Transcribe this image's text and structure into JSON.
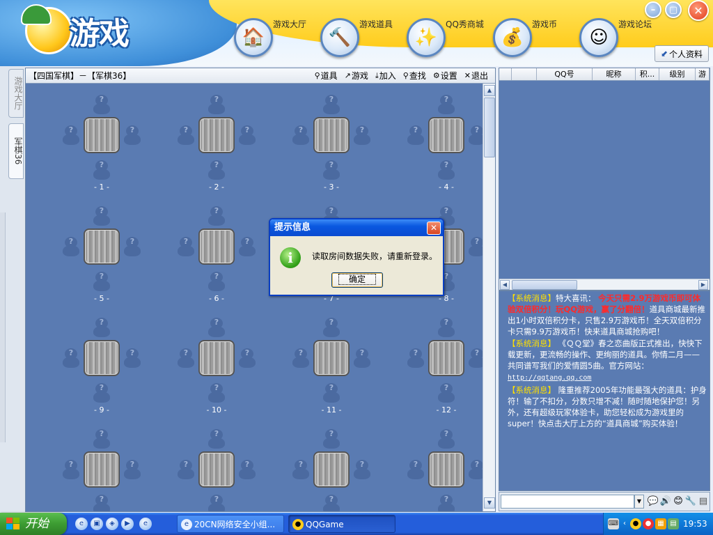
{
  "header": {
    "logo_text": "游戏",
    "nav": [
      {
        "label": "游戏大厅",
        "icon": "house-icon"
      },
      {
        "label": "游戏道具",
        "icon": "hammer-icon"
      },
      {
        "label": "QQ秀商城",
        "icon": "magic-wand-icon"
      },
      {
        "label": "游戏币",
        "icon": "coins-icon"
      },
      {
        "label": "游戏论坛",
        "icon": "avatar-icon"
      }
    ],
    "profile_label": "个人资料"
  },
  "left_tabs": {
    "lobby": "游戏大厅",
    "room": "军棋36"
  },
  "room": {
    "title": "【四国军棋】－【军棋36】",
    "tools": [
      {
        "label": "道具",
        "icon": "magnifier-icon"
      },
      {
        "label": "游戏",
        "icon": "arrow-icon"
      },
      {
        "label": "加入",
        "icon": "download-icon"
      },
      {
        "label": "查找",
        "icon": "search-icon"
      },
      {
        "label": "设置",
        "icon": "gear-icon"
      },
      {
        "label": "退出",
        "icon": "close-icon"
      }
    ],
    "tables": [
      "- 1 -",
      "- 2 -",
      "- 3 -",
      "- 4 -",
      "- 5 -",
      "- 6 -",
      "- 7 -",
      "- 8 -",
      "- 9 -",
      "- 10 -",
      "- 11 -",
      "- 12 -",
      "",
      "",
      "",
      ""
    ],
    "seat_mark": "?"
  },
  "userlist": {
    "columns": [
      "",
      "",
      "QQ号",
      "昵称",
      "积...",
      "级别",
      "游"
    ]
  },
  "messages": {
    "m1_tag": "【系统消息】",
    "m1_a": "特大喜讯：",
    "m1_hl": "今天只需2.9万游戏币即可体验双倍积分！玩QQ游戏，赢了分翻倍！",
    "m1_b": "道具商城最新推出1小时双倍积分卡，只售2.9万游戏币！全天双倍积分卡只需9.9万游戏币！快来道具商城抢购吧！",
    "m2_tag": "【系统消息】",
    "m2_a": "《ＱＱ堂》春之恋曲版正式推出，快快下载更新，更流畅的操作、更绚丽的道具。你情二月——共同谱写我们的爱情圆5曲。官方网站：",
    "m2_link": "http://qqtang.qq.com",
    "m3_tag": "【系统消息】",
    "m3_a": "隆重推荐2005年功能最强大的道具：护身符！输了不扣分，分数只增不减！随时随地保护您！另外，还有超级玩家体验卡，助您轻松成为游戏里的super！快点击大厅上方的“道具商城”购买体验！"
  },
  "dialog": {
    "title": "提示信息",
    "message": "读取房间数据失败，请重新登录。",
    "ok_label": "确定"
  },
  "taskbar": {
    "start_label": "开始",
    "task1": "20CN网络安全小组...",
    "task2": "QQGame",
    "clock": "19:53"
  },
  "colors": {
    "panel_bg": "#5a7bb2",
    "header_yellow": "#ffcc1c",
    "taskbar_blue": "#245edb",
    "start_green": "#3c9c32",
    "dialog_title_blue": "#0a58e0",
    "message_tag": "#ffe000",
    "message_highlight": "#ff2a2a"
  }
}
